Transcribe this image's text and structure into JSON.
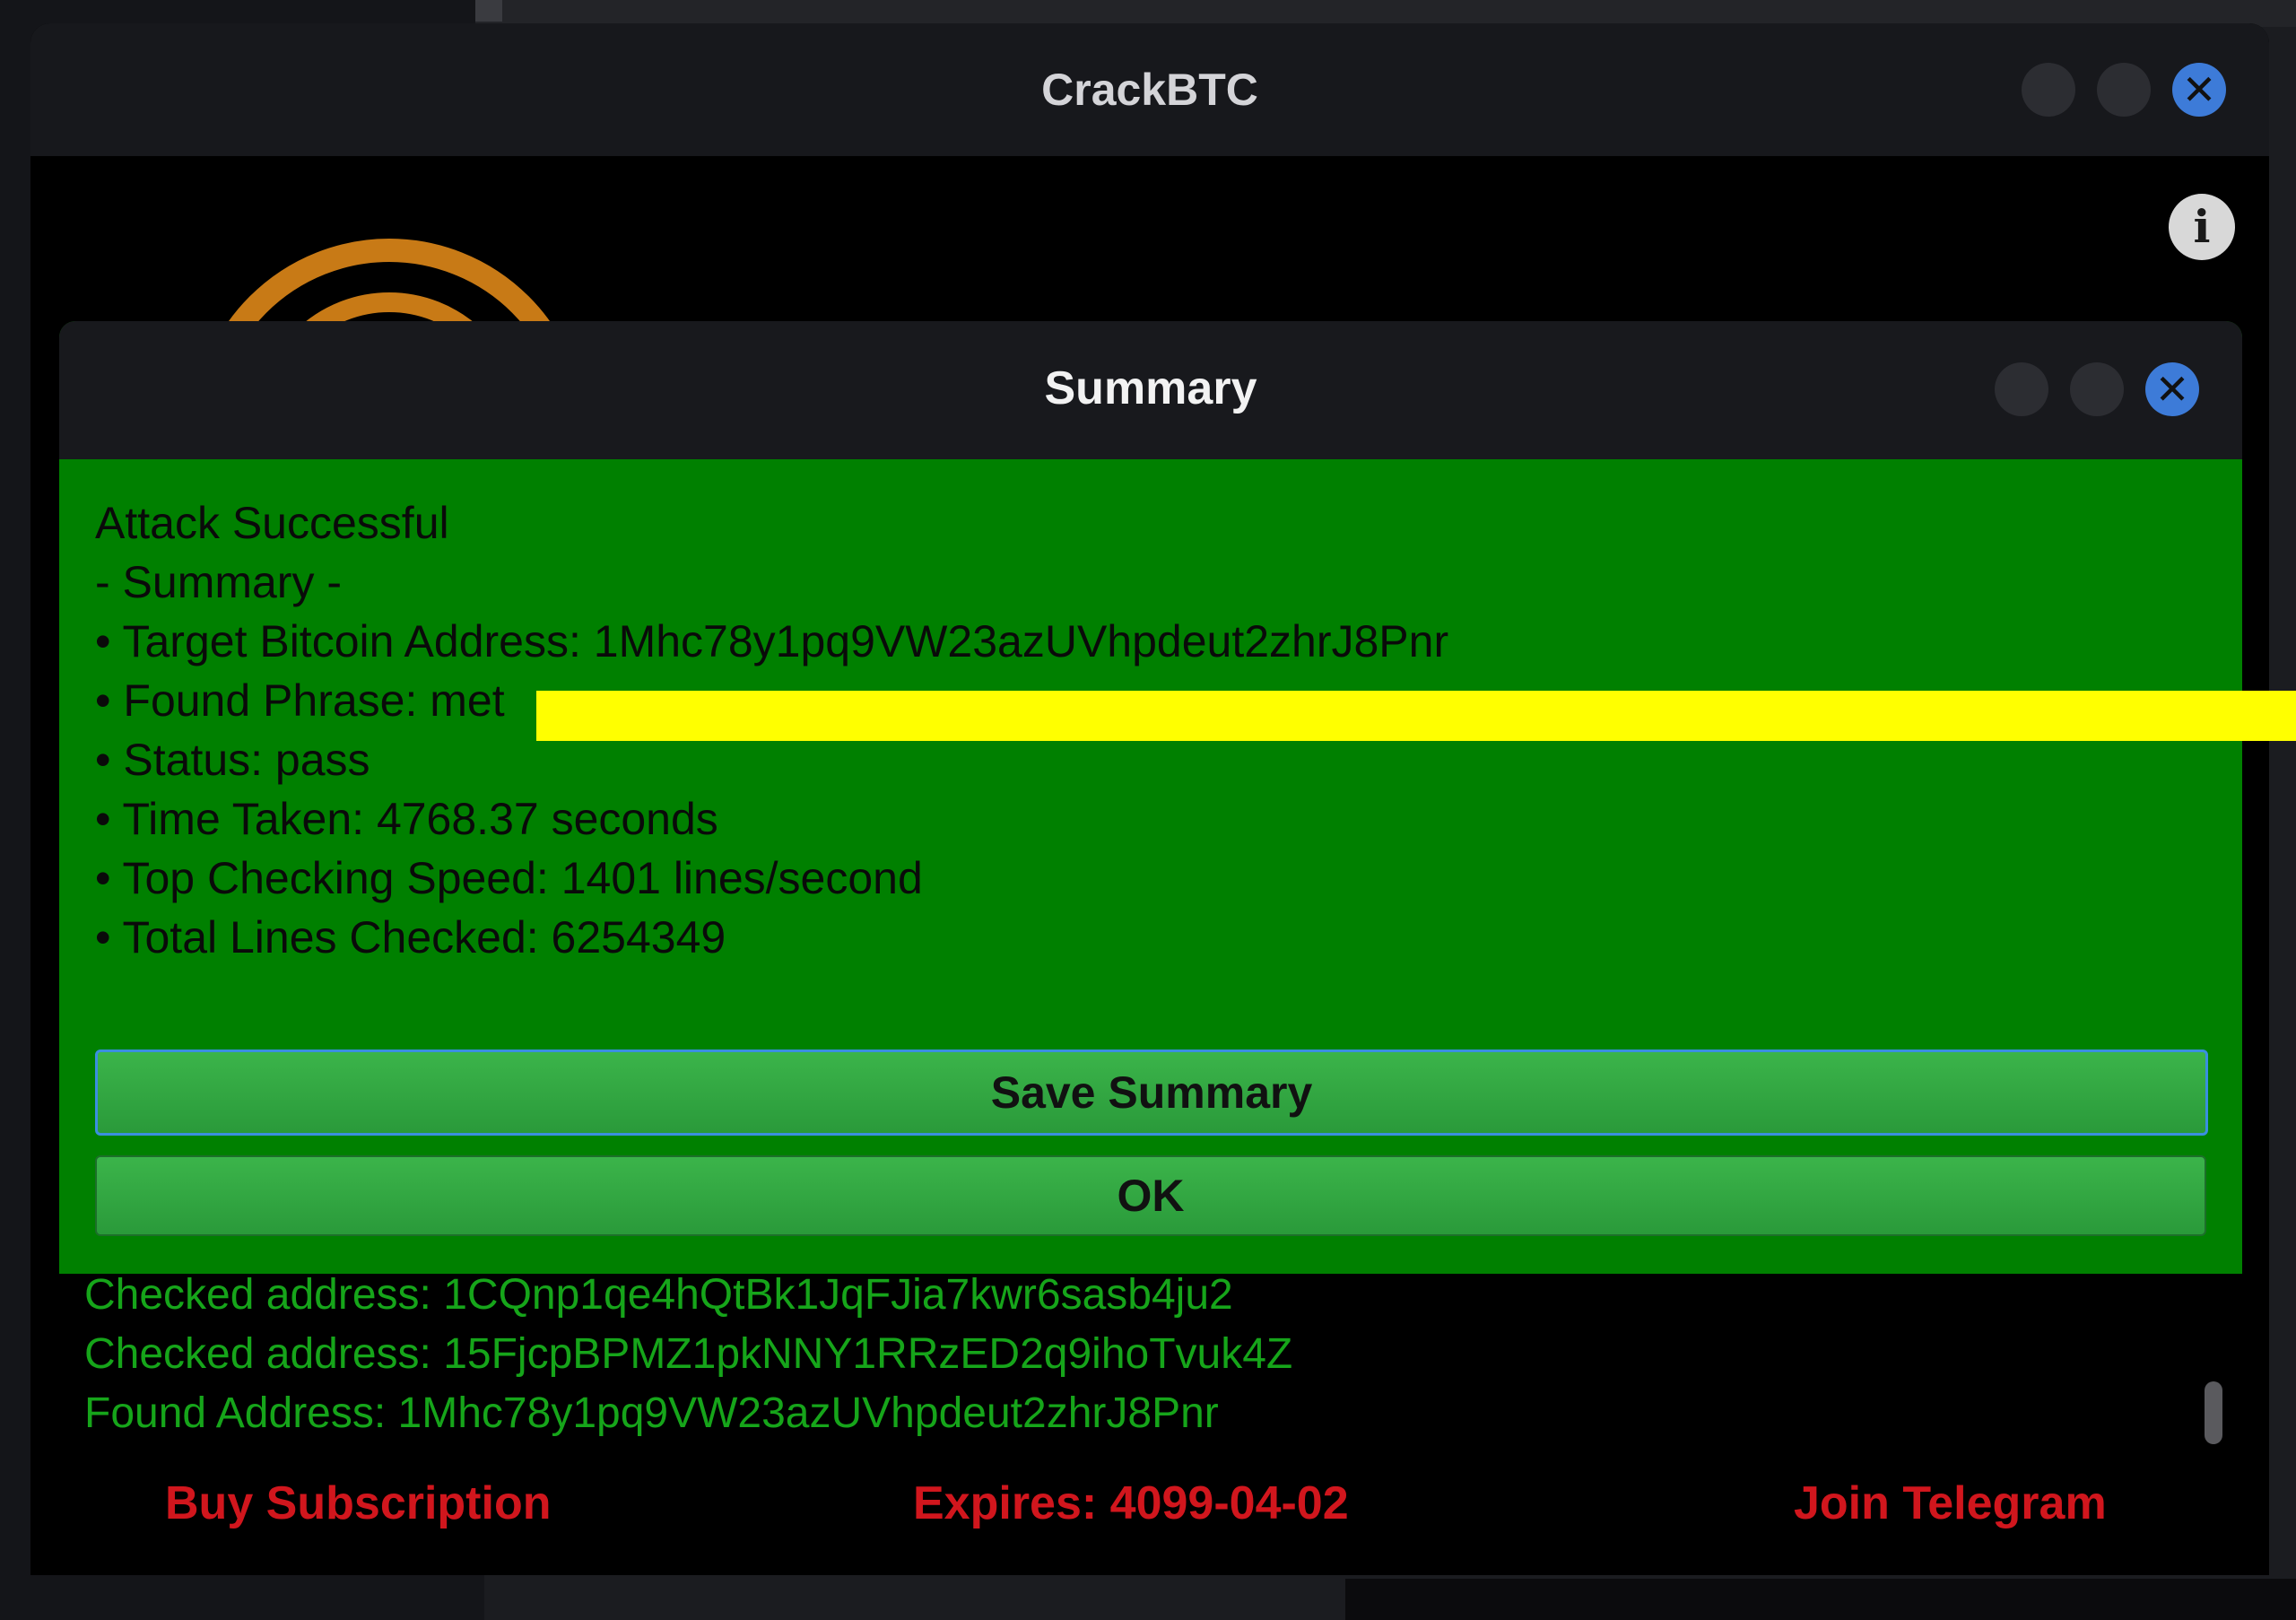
{
  "main_window": {
    "title": "CrackBTC",
    "info_icon": "i",
    "log_lines": [
      "Checked address: 1CQnp1qe4hQtBk1JqFJia7kwr6sasb4ju2",
      "Checked address: 15FjcpBPMZ1pkNNY1RRzED2q9ihoTvuk4Z",
      "Found Address: 1Mhc78y1pq9VW23azUVhpdeut2zhrJ8Pnr"
    ],
    "footer": {
      "buy": "Buy Subscription",
      "expires": "Expires: 4099-04-02",
      "telegram": "Join Telegram"
    }
  },
  "dialog": {
    "title": "Summary",
    "close_glyph": "✕",
    "lines": [
      "Attack Successful",
      "- Summary -",
      "• Target Bitcoin Address: 1Mhc78y1pq9VW23azUVhpdeut2zhrJ8Pnr",
      "• Found Phrase: met",
      "• Status: pass",
      "• Time Taken: 4768.37 seconds",
      "• Top Checking Speed: 1401 lines/second",
      "• Total Lines Checked: 6254349"
    ],
    "save_button": "Save Summary",
    "ok_button": "OK"
  },
  "colors": {
    "accent": "#3d7bd8",
    "dialog_bg": "#008000",
    "log_text": "#16a51a",
    "footer_text": "#d1161d",
    "redaction": "#ffff00"
  }
}
